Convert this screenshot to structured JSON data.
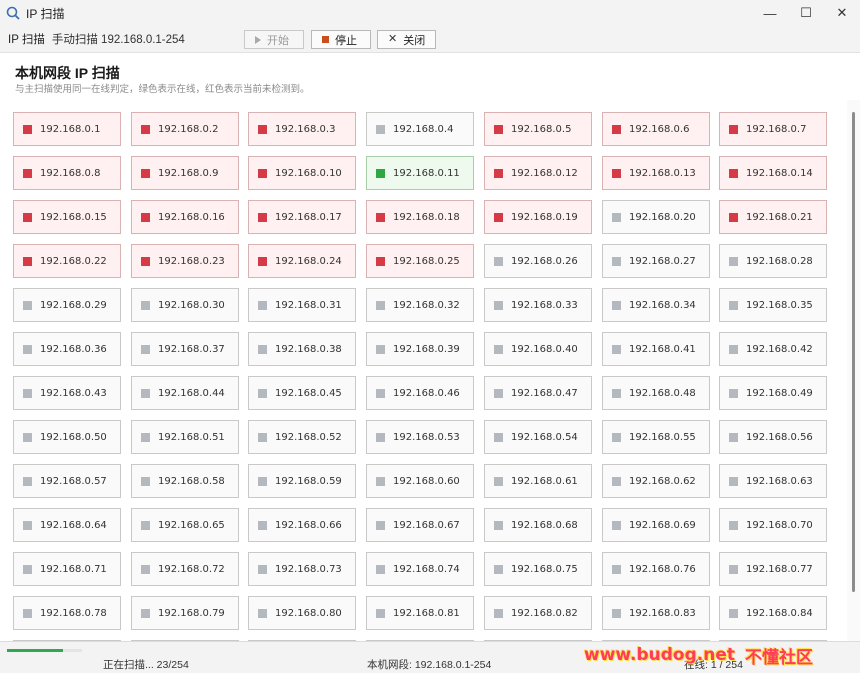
{
  "window": {
    "title": "IP 扫描",
    "minimize_glyph": "—",
    "maximize_glyph": "☐",
    "close_glyph": "✕"
  },
  "toolbar": {
    "app_label": "IP 扫描",
    "mode_label": "手动扫描 192.168.0.1-254",
    "start_label": "开始",
    "stop_label": "停止",
    "close_label": "关闭"
  },
  "header": {
    "title": "本机网段 IP 扫描",
    "subtitle": "与主扫描使用同一在线判定，绿色表示在线，红色表示当前未检测到。"
  },
  "colors": {
    "online": "#2ea843",
    "offline": "#d63a47",
    "pending": "#b4b8bf",
    "progress": "#2fa84f"
  },
  "ips": [
    {
      "ip": "192.168.0.1",
      "status": "offline"
    },
    {
      "ip": "192.168.0.2",
      "status": "offline"
    },
    {
      "ip": "192.168.0.3",
      "status": "offline"
    },
    {
      "ip": "192.168.0.4",
      "status": "pending"
    },
    {
      "ip": "192.168.0.5",
      "status": "offline"
    },
    {
      "ip": "192.168.0.6",
      "status": "offline"
    },
    {
      "ip": "192.168.0.7",
      "status": "offline"
    },
    {
      "ip": "192.168.0.8",
      "status": "offline"
    },
    {
      "ip": "192.168.0.9",
      "status": "offline"
    },
    {
      "ip": "192.168.0.10",
      "status": "offline"
    },
    {
      "ip": "192.168.0.11",
      "status": "online"
    },
    {
      "ip": "192.168.0.12",
      "status": "offline"
    },
    {
      "ip": "192.168.0.13",
      "status": "offline"
    },
    {
      "ip": "192.168.0.14",
      "status": "offline"
    },
    {
      "ip": "192.168.0.15",
      "status": "offline"
    },
    {
      "ip": "192.168.0.16",
      "status": "offline"
    },
    {
      "ip": "192.168.0.17",
      "status": "offline"
    },
    {
      "ip": "192.168.0.18",
      "status": "offline"
    },
    {
      "ip": "192.168.0.19",
      "status": "offline"
    },
    {
      "ip": "192.168.0.20",
      "status": "pending"
    },
    {
      "ip": "192.168.0.21",
      "status": "offline"
    },
    {
      "ip": "192.168.0.22",
      "status": "offline"
    },
    {
      "ip": "192.168.0.23",
      "status": "offline"
    },
    {
      "ip": "192.168.0.24",
      "status": "offline"
    },
    {
      "ip": "192.168.0.25",
      "status": "offline"
    },
    {
      "ip": "192.168.0.26",
      "status": "pending"
    },
    {
      "ip": "192.168.0.27",
      "status": "pending"
    },
    {
      "ip": "192.168.0.28",
      "status": "pending"
    },
    {
      "ip": "192.168.0.29",
      "status": "pending"
    },
    {
      "ip": "192.168.0.30",
      "status": "pending"
    },
    {
      "ip": "192.168.0.31",
      "status": "pending"
    },
    {
      "ip": "192.168.0.32",
      "status": "pending"
    },
    {
      "ip": "192.168.0.33",
      "status": "pending"
    },
    {
      "ip": "192.168.0.34",
      "status": "pending"
    },
    {
      "ip": "192.168.0.35",
      "status": "pending"
    },
    {
      "ip": "192.168.0.36",
      "status": "pending"
    },
    {
      "ip": "192.168.0.37",
      "status": "pending"
    },
    {
      "ip": "192.168.0.38",
      "status": "pending"
    },
    {
      "ip": "192.168.0.39",
      "status": "pending"
    },
    {
      "ip": "192.168.0.40",
      "status": "pending"
    },
    {
      "ip": "192.168.0.41",
      "status": "pending"
    },
    {
      "ip": "192.168.0.42",
      "status": "pending"
    },
    {
      "ip": "192.168.0.43",
      "status": "pending"
    },
    {
      "ip": "192.168.0.44",
      "status": "pending"
    },
    {
      "ip": "192.168.0.45",
      "status": "pending"
    },
    {
      "ip": "192.168.0.46",
      "status": "pending"
    },
    {
      "ip": "192.168.0.47",
      "status": "pending"
    },
    {
      "ip": "192.168.0.48",
      "status": "pending"
    },
    {
      "ip": "192.168.0.49",
      "status": "pending"
    },
    {
      "ip": "192.168.0.50",
      "status": "pending"
    },
    {
      "ip": "192.168.0.51",
      "status": "pending"
    },
    {
      "ip": "192.168.0.52",
      "status": "pending"
    },
    {
      "ip": "192.168.0.53",
      "status": "pending"
    },
    {
      "ip": "192.168.0.54",
      "status": "pending"
    },
    {
      "ip": "192.168.0.55",
      "status": "pending"
    },
    {
      "ip": "192.168.0.56",
      "status": "pending"
    },
    {
      "ip": "192.168.0.57",
      "status": "pending"
    },
    {
      "ip": "192.168.0.58",
      "status": "pending"
    },
    {
      "ip": "192.168.0.59",
      "status": "pending"
    },
    {
      "ip": "192.168.0.60",
      "status": "pending"
    },
    {
      "ip": "192.168.0.61",
      "status": "pending"
    },
    {
      "ip": "192.168.0.62",
      "status": "pending"
    },
    {
      "ip": "192.168.0.63",
      "status": "pending"
    },
    {
      "ip": "192.168.0.64",
      "status": "pending"
    },
    {
      "ip": "192.168.0.65",
      "status": "pending"
    },
    {
      "ip": "192.168.0.66",
      "status": "pending"
    },
    {
      "ip": "192.168.0.67",
      "status": "pending"
    },
    {
      "ip": "192.168.0.68",
      "status": "pending"
    },
    {
      "ip": "192.168.0.69",
      "status": "pending"
    },
    {
      "ip": "192.168.0.70",
      "status": "pending"
    },
    {
      "ip": "192.168.0.71",
      "status": "pending"
    },
    {
      "ip": "192.168.0.72",
      "status": "pending"
    },
    {
      "ip": "192.168.0.73",
      "status": "pending"
    },
    {
      "ip": "192.168.0.74",
      "status": "pending"
    },
    {
      "ip": "192.168.0.75",
      "status": "pending"
    },
    {
      "ip": "192.168.0.76",
      "status": "pending"
    },
    {
      "ip": "192.168.0.77",
      "status": "pending"
    },
    {
      "ip": "192.168.0.78",
      "status": "pending"
    },
    {
      "ip": "192.168.0.79",
      "status": "pending"
    },
    {
      "ip": "192.168.0.80",
      "status": "pending"
    },
    {
      "ip": "192.168.0.81",
      "status": "pending"
    },
    {
      "ip": "192.168.0.82",
      "status": "pending"
    },
    {
      "ip": "192.168.0.83",
      "status": "pending"
    },
    {
      "ip": "192.168.0.84",
      "status": "pending"
    }
  ],
  "status": {
    "scanning": "正在扫描... 23/254",
    "segment": "本机网段: 192.168.0.1-254",
    "online_count": "在线: 1 / 254",
    "progress": 0.09
  },
  "watermark": {
    "url": "www.budog.net",
    "name": "不懂社区"
  }
}
